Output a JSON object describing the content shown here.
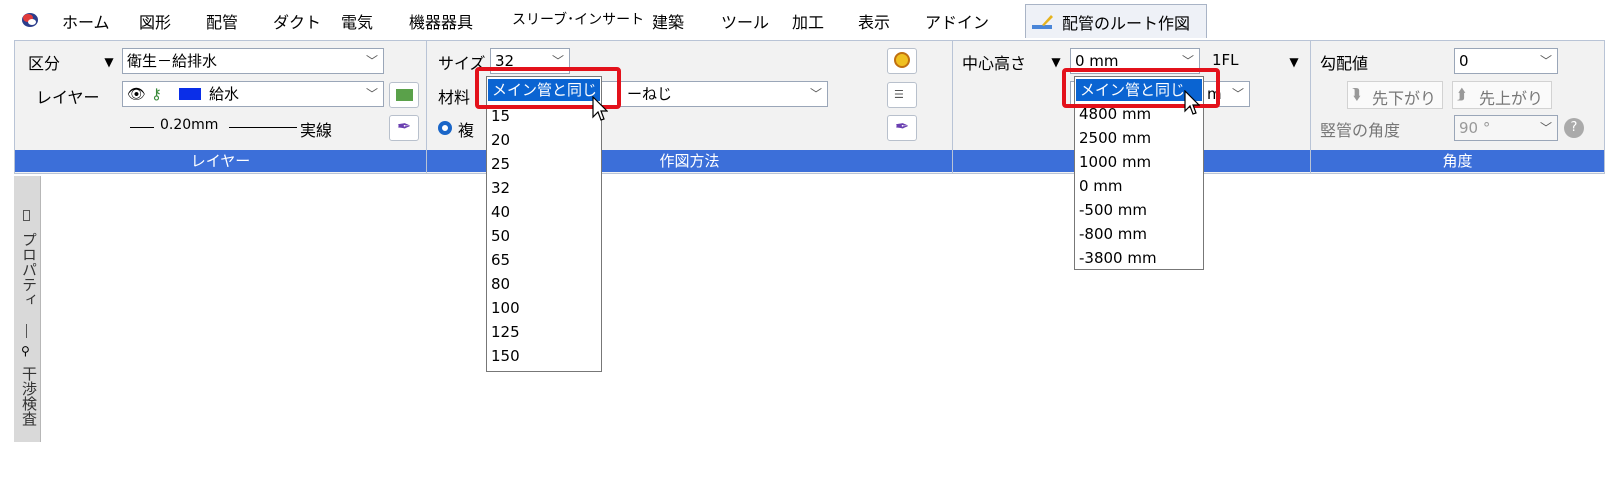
{
  "menubar": {
    "items": [
      "ホーム",
      "図形",
      "配管",
      "ダクト",
      "電気",
      "機器器具",
      "スリーブ･インサート",
      "建築",
      "ツール",
      "加工",
      "表示",
      "アドイン"
    ],
    "active_tab": "配管のルート作図"
  },
  "layer_group": {
    "section_label": "区分",
    "section_value": "衛生－給排水",
    "layer_label": "レイヤー",
    "layer_value": "給水",
    "line_width": "0.20mm",
    "line_type": "実線",
    "group_label": "レイヤー"
  },
  "draw_group": {
    "size_label": "サイズ",
    "size_value": "32",
    "material_label": "材料",
    "material_value_suffix": "ーねじ",
    "radio_label": "複",
    "group_label": "作図方法",
    "size_dropdown": {
      "selected": "メイン管と同じ",
      "options": [
        "15",
        "20",
        "25",
        "32",
        "40",
        "50",
        "65",
        "80",
        "100",
        "125",
        "150"
      ]
    }
  },
  "height_group": {
    "center_height_label": "中心高さ",
    "center_height_value": "0 mm",
    "reference": "1FL",
    "second_value_suffix": "m",
    "height_dropdown": {
      "selected": "メイン管と同じ",
      "options": [
        "4800 mm",
        "2500 mm",
        "1000 mm",
        "0 mm",
        "-500 mm",
        "-800 mm",
        "-3800 mm"
      ]
    }
  },
  "angle_group": {
    "slope_label": "勾配値",
    "slope_value": "0",
    "down_button": "先下がり",
    "up_button": "先上がり",
    "riser_label": "竪管の角度",
    "riser_value": "90 °",
    "group_label": "角度"
  },
  "side_panel": {
    "tab1": "プロパティ",
    "tab2": "干渉検査"
  },
  "colors": {
    "accent": "#3c6fd9",
    "highlight": "#0a64d2",
    "callout": "#e3111b"
  }
}
